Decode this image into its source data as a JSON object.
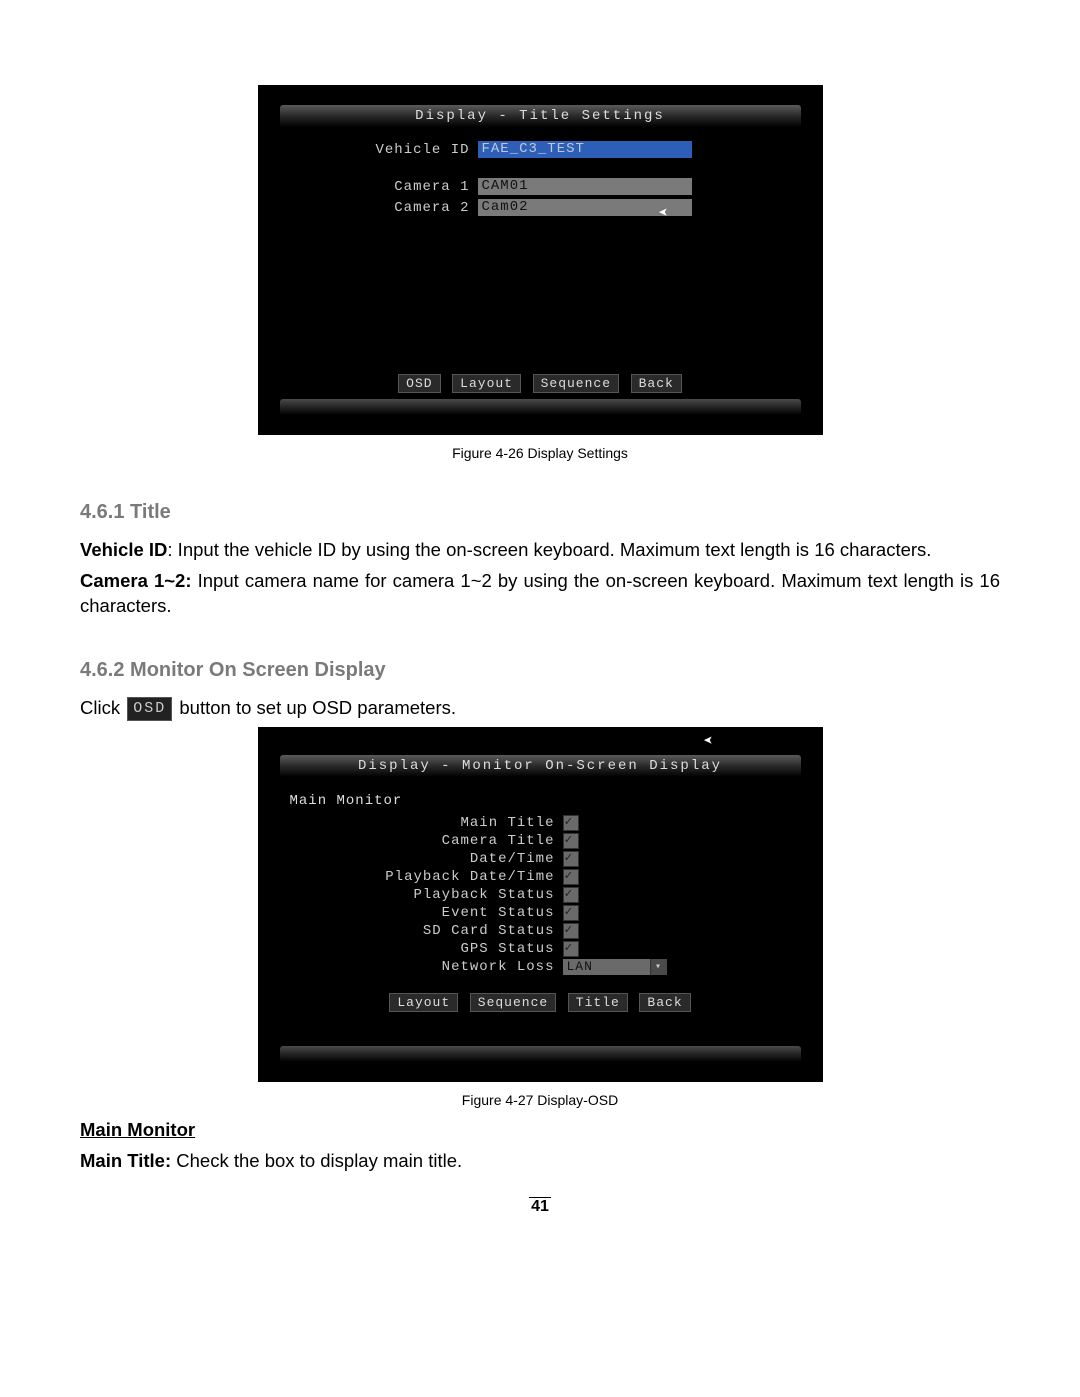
{
  "device1": {
    "titlebar": "Display - Title Settings",
    "vehicle_id_label": "Vehicle ID",
    "vehicle_id_value": "FAE_C3_TEST",
    "camera1_label": "Camera 1",
    "camera1_value": "CAM01",
    "camera2_label": "Camera 2",
    "camera2_value": "Cam02",
    "tabs": {
      "osd": "OSD",
      "layout": "Layout",
      "sequence": "Sequence",
      "back": "Back"
    }
  },
  "caption1": "Figure 4-26 Display Settings",
  "sec461": {
    "heading": "4.6.1 Title",
    "p1_b": "Vehicle ID",
    "p1_rest": ": Input the vehicle ID by using the on-screen keyboard. Maximum text length is 16 characters.",
    "p2_b": "Camera 1~2:",
    "p2_rest": " Input camera name for camera 1~2 by using the on-screen keyboard. Maximum text length is 16 characters."
  },
  "sec462": {
    "heading": "4.6.2 Monitor On Screen Display",
    "click_pre": "Click ",
    "osd_btn": "OSD",
    "click_post": " button to set up OSD parameters."
  },
  "device2": {
    "titlebar": "Display - Monitor On-Screen Display",
    "section": "Main Monitor",
    "rows": {
      "main_title": "Main Title",
      "camera_title": "Camera Title",
      "date_time": "Date/Time",
      "playback_dt": "Playback Date/Time",
      "playback_status": "Playback Status",
      "event_status": "Event Status",
      "sd_status": "SD Card Status",
      "gps_status": "GPS Status",
      "network_loss": "Network Loss"
    },
    "network_loss_value": "LAN",
    "tabs": {
      "layout": "Layout",
      "sequence": "Sequence",
      "title": "Title",
      "back": "Back"
    }
  },
  "caption2": "Figure 4-27 Display-OSD",
  "main_monitor_heading": "Main Monitor",
  "main_title_b": "Main Title:",
  "main_title_rest": " Check the box to display main title.",
  "page_number": "41"
}
